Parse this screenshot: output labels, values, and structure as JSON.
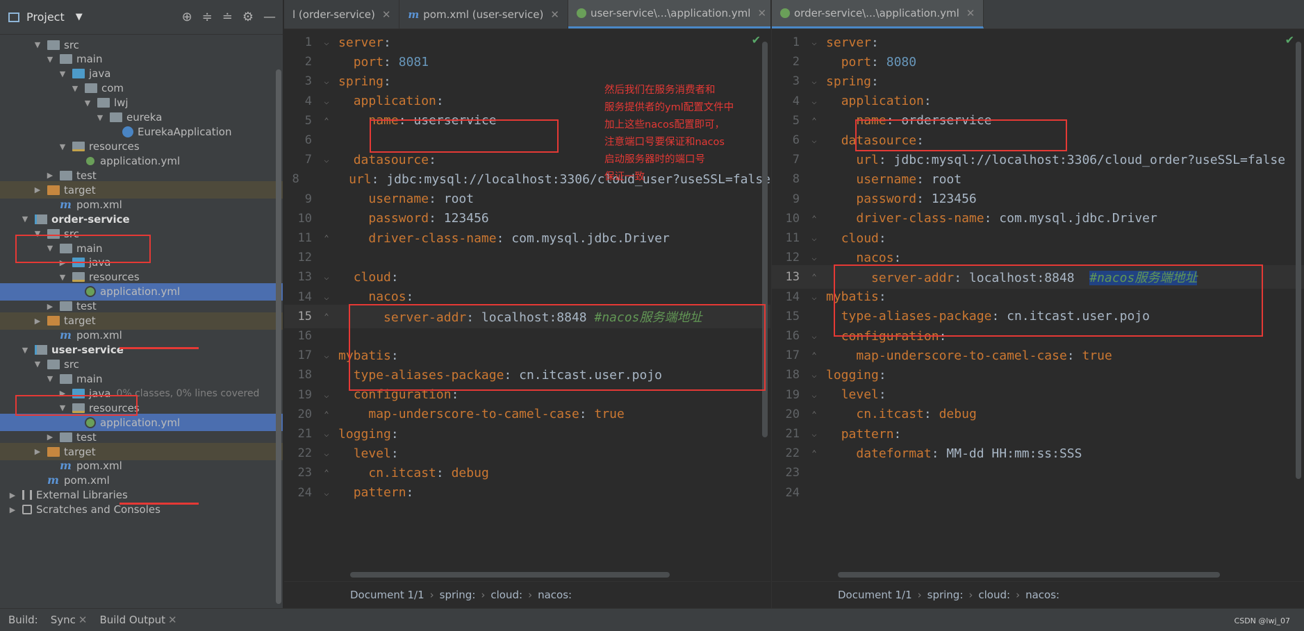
{
  "project_panel": {
    "title": "Project",
    "tree": [
      {
        "label": "src",
        "indent": 1,
        "arrow": "v",
        "icon": "folder"
      },
      {
        "label": "main",
        "indent": 2,
        "arrow": "v",
        "icon": "folder"
      },
      {
        "label": "java",
        "indent": 3,
        "arrow": "v",
        "icon": "folder-blue"
      },
      {
        "label": "com",
        "indent": 4,
        "arrow": "v",
        "icon": "package"
      },
      {
        "label": "lwj",
        "indent": 5,
        "arrow": "v",
        "icon": "package"
      },
      {
        "label": "eureka",
        "indent": 6,
        "arrow": "v",
        "icon": "package"
      },
      {
        "label": "EurekaApplication",
        "indent": 7,
        "arrow": "",
        "icon": "app"
      },
      {
        "label": "resources",
        "indent": 3,
        "arrow": "v",
        "icon": "resources"
      },
      {
        "label": "application.yml",
        "indent": 4,
        "arrow": "",
        "icon": "yml"
      },
      {
        "label": "test",
        "indent": 2,
        "arrow": ">",
        "icon": "folder"
      },
      {
        "label": "target",
        "indent": 1,
        "arrow": ">",
        "icon": "target",
        "style": "tgt"
      },
      {
        "label": "pom.xml",
        "indent": 2,
        "arrow": "",
        "icon": "maven"
      },
      {
        "label": "order-service",
        "indent": 0,
        "arrow": "v",
        "icon": "module",
        "style": "mod"
      },
      {
        "label": "src",
        "indent": 1,
        "arrow": "v",
        "icon": "folder"
      },
      {
        "label": "main",
        "indent": 2,
        "arrow": "v",
        "icon": "folder"
      },
      {
        "label": "java",
        "indent": 3,
        "arrow": ">",
        "icon": "folder-blue"
      },
      {
        "label": "resources",
        "indent": 3,
        "arrow": "v",
        "icon": "resources"
      },
      {
        "label": "application.yml",
        "indent": 4,
        "arrow": "",
        "icon": "yml",
        "style": "sel"
      },
      {
        "label": "test",
        "indent": 2,
        "arrow": ">",
        "icon": "folder"
      },
      {
        "label": "target",
        "indent": 1,
        "arrow": ">",
        "icon": "target",
        "style": "tgt"
      },
      {
        "label": "pom.xml",
        "indent": 2,
        "arrow": "",
        "icon": "maven"
      },
      {
        "label": "user-service",
        "indent": 0,
        "arrow": "v",
        "icon": "module",
        "style": "mod"
      },
      {
        "label": "src",
        "indent": 1,
        "arrow": "v",
        "icon": "folder"
      },
      {
        "label": "main",
        "indent": 2,
        "arrow": "v",
        "icon": "folder"
      },
      {
        "label": "java",
        "indent": 3,
        "arrow": ">",
        "icon": "folder-blue",
        "hint": "0% classes, 0% lines covered"
      },
      {
        "label": "resources",
        "indent": 3,
        "arrow": "v",
        "icon": "resources"
      },
      {
        "label": "application.yml",
        "indent": 4,
        "arrow": "",
        "icon": "yml",
        "style": "sel"
      },
      {
        "label": "test",
        "indent": 2,
        "arrow": ">",
        "icon": "folder"
      },
      {
        "label": "target",
        "indent": 1,
        "arrow": ">",
        "icon": "target",
        "style": "tgt"
      },
      {
        "label": "pom.xml",
        "indent": 2,
        "arrow": "",
        "icon": "maven"
      },
      {
        "label": "pom.xml",
        "indent": 1,
        "arrow": "",
        "icon": "maven"
      },
      {
        "label": "External Libraries",
        "indent": -1,
        "arrow": ">",
        "icon": "libraries"
      },
      {
        "label": "Scratches and Consoles",
        "indent": -1,
        "arrow": ">",
        "icon": "scratches"
      }
    ]
  },
  "left_editor": {
    "tabs": [
      {
        "label": "l (order-service)",
        "icon": "",
        "active": false
      },
      {
        "label": "pom.xml (user-service)",
        "icon": "maven",
        "active": false
      },
      {
        "label": "user-service\\...\\application.yml",
        "icon": "yml",
        "active": true
      }
    ],
    "lines": [
      {
        "n": "1",
        "fold": "open",
        "parts": [
          [
            "k",
            "server"
          ],
          [
            "v",
            ":"
          ]
        ]
      },
      {
        "n": "2",
        "fold": "",
        "parts": [
          [
            "v",
            "  "
          ],
          [
            "k",
            "port"
          ],
          [
            "v",
            ": "
          ],
          [
            "n",
            "8081"
          ]
        ]
      },
      {
        "n": "3",
        "fold": "open",
        "parts": [
          [
            "k",
            "spring"
          ],
          [
            "v",
            ":"
          ]
        ]
      },
      {
        "n": "4",
        "fold": "open",
        "parts": [
          [
            "v",
            "  "
          ],
          [
            "k",
            "application"
          ],
          [
            "v",
            ":"
          ]
        ]
      },
      {
        "n": "5",
        "fold": "close",
        "parts": [
          [
            "v",
            "    "
          ],
          [
            "k",
            "name"
          ],
          [
            "v",
            ": userservice"
          ]
        ]
      },
      {
        "n": "6",
        "fold": "",
        "parts": []
      },
      {
        "n": "7",
        "fold": "open",
        "parts": [
          [
            "v",
            "  "
          ],
          [
            "k",
            "datasource"
          ],
          [
            "v",
            ":"
          ]
        ]
      },
      {
        "n": "8",
        "fold": "",
        "parts": [
          [
            "v",
            "    "
          ],
          [
            "k",
            "url"
          ],
          [
            "v",
            ": jdbc:mysql://localhost:3306/cloud_user?useSSL=false"
          ]
        ]
      },
      {
        "n": "9",
        "fold": "",
        "parts": [
          [
            "v",
            "    "
          ],
          [
            "k",
            "username"
          ],
          [
            "v",
            ": root"
          ]
        ]
      },
      {
        "n": "10",
        "fold": "",
        "parts": [
          [
            "v",
            "    "
          ],
          [
            "k",
            "password"
          ],
          [
            "v",
            ": 123456"
          ]
        ]
      },
      {
        "n": "11",
        "fold": "close",
        "parts": [
          [
            "v",
            "    "
          ],
          [
            "k",
            "driver-class-name"
          ],
          [
            "v",
            ": com.mysql.jdbc.Driver"
          ]
        ]
      },
      {
        "n": "12",
        "fold": "",
        "parts": []
      },
      {
        "n": "13",
        "fold": "open",
        "parts": [
          [
            "v",
            "  "
          ],
          [
            "k",
            "cloud"
          ],
          [
            "v",
            ":"
          ]
        ]
      },
      {
        "n": "14",
        "fold": "open",
        "parts": [
          [
            "v",
            "    "
          ],
          [
            "k",
            "nacos"
          ],
          [
            "v",
            ":"
          ]
        ]
      },
      {
        "n": "15",
        "fold": "close",
        "cur": true,
        "parts": [
          [
            "v",
            "      "
          ],
          [
            "k",
            "server-addr"
          ],
          [
            "v",
            ": localhost:8848 "
          ],
          [
            "c",
            "#nacos服务端地址"
          ]
        ]
      },
      {
        "n": "16",
        "fold": "",
        "parts": []
      },
      {
        "n": "17",
        "fold": "open",
        "parts": [
          [
            "k",
            "mybatis"
          ],
          [
            "v",
            ":"
          ]
        ]
      },
      {
        "n": "18",
        "fold": "",
        "parts": [
          [
            "v",
            "  "
          ],
          [
            "k",
            "type-aliases-package"
          ],
          [
            "v",
            ": cn.itcast.user.pojo"
          ]
        ]
      },
      {
        "n": "19",
        "fold": "open",
        "parts": [
          [
            "v",
            "  "
          ],
          [
            "k",
            "configuration"
          ],
          [
            "v",
            ":"
          ]
        ]
      },
      {
        "n": "20",
        "fold": "close",
        "parts": [
          [
            "v",
            "    "
          ],
          [
            "k",
            "map-underscore-to-camel-case"
          ],
          [
            "v",
            ": "
          ],
          [
            "k",
            "true"
          ]
        ]
      },
      {
        "n": "21",
        "fold": "open",
        "parts": [
          [
            "k",
            "logging"
          ],
          [
            "v",
            ":"
          ]
        ]
      },
      {
        "n": "22",
        "fold": "open",
        "parts": [
          [
            "v",
            "  "
          ],
          [
            "k",
            "level"
          ],
          [
            "v",
            ":"
          ]
        ]
      },
      {
        "n": "23",
        "fold": "close",
        "parts": [
          [
            "v",
            "    "
          ],
          [
            "k",
            "cn.itcast"
          ],
          [
            "v",
            ": "
          ],
          [
            "k",
            "debug"
          ]
        ]
      },
      {
        "n": "24",
        "fold": "open",
        "parts": [
          [
            "v",
            "  "
          ],
          [
            "k",
            "pattern"
          ],
          [
            "v",
            ":"
          ]
        ]
      }
    ],
    "breadcrumb": [
      "Document 1/1",
      "spring:",
      "cloud:",
      "nacos:"
    ]
  },
  "right_editor": {
    "tabs": [
      {
        "label": "order-service\\...\\application.yml",
        "icon": "yml",
        "active": true
      }
    ],
    "lines": [
      {
        "n": "1",
        "fold": "open",
        "parts": [
          [
            "k",
            "server"
          ],
          [
            "v",
            ":"
          ]
        ]
      },
      {
        "n": "2",
        "fold": "",
        "parts": [
          [
            "v",
            "  "
          ],
          [
            "k",
            "port"
          ],
          [
            "v",
            ": "
          ],
          [
            "n",
            "8080"
          ]
        ]
      },
      {
        "n": "3",
        "fold": "open",
        "parts": [
          [
            "k",
            "spring"
          ],
          [
            "v",
            ":"
          ]
        ]
      },
      {
        "n": "4",
        "fold": "open",
        "parts": [
          [
            "v",
            "  "
          ],
          [
            "k",
            "application"
          ],
          [
            "v",
            ":"
          ]
        ]
      },
      {
        "n": "5",
        "fold": "close",
        "parts": [
          [
            "v",
            "    "
          ],
          [
            "k",
            "name"
          ],
          [
            "v",
            ": orderservice"
          ]
        ]
      },
      {
        "n": "6",
        "fold": "open",
        "parts": [
          [
            "v",
            "  "
          ],
          [
            "k",
            "datasource"
          ],
          [
            "v",
            ":"
          ]
        ]
      },
      {
        "n": "7",
        "fold": "",
        "parts": [
          [
            "v",
            "    "
          ],
          [
            "k",
            "url"
          ],
          [
            "v",
            ": jdbc:mysql://localhost:3306/cloud_order?useSSL=false"
          ]
        ]
      },
      {
        "n": "8",
        "fold": "",
        "parts": [
          [
            "v",
            "    "
          ],
          [
            "k",
            "username"
          ],
          [
            "v",
            ": root"
          ]
        ]
      },
      {
        "n": "9",
        "fold": "",
        "parts": [
          [
            "v",
            "    "
          ],
          [
            "k",
            "password"
          ],
          [
            "v",
            ": 123456"
          ]
        ]
      },
      {
        "n": "10",
        "fold": "close",
        "parts": [
          [
            "v",
            "    "
          ],
          [
            "k",
            "driver-class-name"
          ],
          [
            "v",
            ": com.mysql.jdbc.Driver"
          ]
        ]
      },
      {
        "n": "11",
        "fold": "open",
        "parts": [
          [
            "v",
            "  "
          ],
          [
            "k",
            "cloud"
          ],
          [
            "v",
            ":"
          ]
        ]
      },
      {
        "n": "12",
        "fold": "open",
        "parts": [
          [
            "v",
            "    "
          ],
          [
            "k",
            "nacos"
          ],
          [
            "v",
            ":"
          ]
        ]
      },
      {
        "n": "13",
        "fold": "close",
        "cur": true,
        "parts": [
          [
            "v",
            "      "
          ],
          [
            "k",
            "server-addr"
          ],
          [
            "v",
            ": localhost:8848  "
          ],
          [
            "ch",
            "#nacos服务端地址"
          ]
        ]
      },
      {
        "n": "14",
        "fold": "open",
        "parts": [
          [
            "k",
            "mybatis"
          ],
          [
            "v",
            ":"
          ]
        ]
      },
      {
        "n": "15",
        "fold": "",
        "parts": [
          [
            "v",
            "  "
          ],
          [
            "k",
            "type-aliases-package"
          ],
          [
            "v",
            ": cn.itcast.user.pojo"
          ]
        ]
      },
      {
        "n": "16",
        "fold": "open",
        "parts": [
          [
            "v",
            "  "
          ],
          [
            "k",
            "configuration"
          ],
          [
            "v",
            ":"
          ]
        ]
      },
      {
        "n": "17",
        "fold": "close",
        "parts": [
          [
            "v",
            "    "
          ],
          [
            "k",
            "map-underscore-to-camel-case"
          ],
          [
            "v",
            ": "
          ],
          [
            "k",
            "true"
          ]
        ]
      },
      {
        "n": "18",
        "fold": "open",
        "parts": [
          [
            "k",
            "logging"
          ],
          [
            "v",
            ":"
          ]
        ]
      },
      {
        "n": "19",
        "fold": "open",
        "parts": [
          [
            "v",
            "  "
          ],
          [
            "k",
            "level"
          ],
          [
            "v",
            ":"
          ]
        ]
      },
      {
        "n": "20",
        "fold": "close",
        "parts": [
          [
            "v",
            "    "
          ],
          [
            "k",
            "cn.itcast"
          ],
          [
            "v",
            ": "
          ],
          [
            "k",
            "debug"
          ]
        ]
      },
      {
        "n": "21",
        "fold": "open",
        "parts": [
          [
            "v",
            "  "
          ],
          [
            "k",
            "pattern"
          ],
          [
            "v",
            ":"
          ]
        ]
      },
      {
        "n": "22",
        "fold": "close",
        "parts": [
          [
            "v",
            "    "
          ],
          [
            "k",
            "dateformat"
          ],
          [
            "v",
            ": MM-dd HH:mm:ss:SSS"
          ]
        ]
      },
      {
        "n": "23",
        "fold": "",
        "parts": []
      },
      {
        "n": "24",
        "fold": "",
        "parts": []
      }
    ],
    "breadcrumb": [
      "Document 1/1",
      "spring:",
      "cloud:",
      "nacos:"
    ]
  },
  "annotation": {
    "lines": [
      "然后我们在服务消费者和",
      "服务提供者的yml配置文件中",
      "加上这些nacos配置即可，",
      "注意端口号要保证和nacos",
      "启动服务器时的端口号",
      "保证一致"
    ]
  },
  "bottom_bar": {
    "build_label": "Build:",
    "tabs": [
      "Sync",
      "Build Output"
    ]
  },
  "watermark": "CSDN @lwj_07",
  "colors": {
    "annotation_red": "#e53935",
    "selection": "#4b6eaf",
    "keyword": "#cc7832",
    "number": "#6897bb",
    "comment": "#629755"
  }
}
